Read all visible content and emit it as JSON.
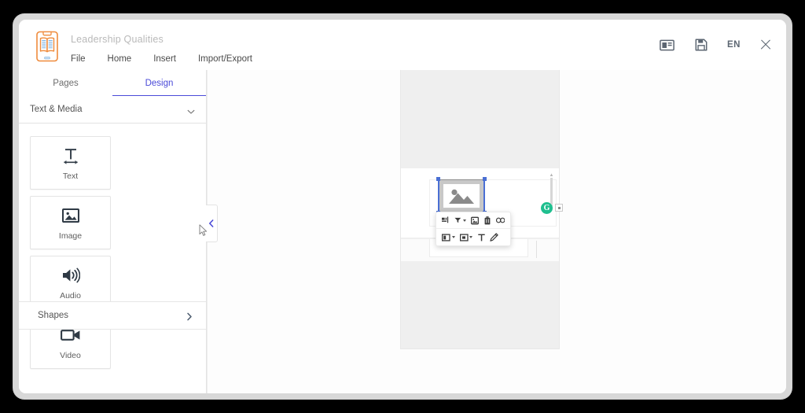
{
  "window": {
    "app_icon": "book-document-icon",
    "document_title": "Leadership Qualities",
    "menu": [
      {
        "label": "File",
        "name": "menu-file"
      },
      {
        "label": "Home",
        "name": "menu-home"
      },
      {
        "label": "Insert",
        "name": "menu-insert"
      },
      {
        "label": "Import/Export",
        "name": "menu-import-export"
      }
    ],
    "header_actions": {
      "layout_icon": "slide-layout-icon",
      "save_icon": "save-floppy-icon",
      "language": "EN",
      "close_icon": "close-icon"
    }
  },
  "left_panel": {
    "tabs": [
      {
        "label": "Pages",
        "active": false
      },
      {
        "label": "Design",
        "active": true
      }
    ],
    "accordion": {
      "label": "Text & Media",
      "expanded": true,
      "chevron": "chevron-down-icon"
    },
    "cards": [
      {
        "label": "Text",
        "icon": "text-size-icon"
      },
      {
        "label": "Image",
        "icon": "image-icon"
      },
      {
        "label": "Audio",
        "icon": "audio-speaker-icon"
      },
      {
        "label": "Video",
        "icon": "video-camera-icon"
      }
    ],
    "shapes": {
      "label": "Shapes",
      "chevron": "chevron-right-icon"
    },
    "collapse_handle": "chevron-left-icon"
  },
  "canvas": {
    "selected_object": {
      "type": "image-placeholder",
      "icon": "image-placeholder-icon",
      "selected": true
    },
    "sync_badge": {
      "label": "G",
      "color": "#1fbf8f",
      "name": "grammar-check-badge"
    },
    "floating_toolbar": {
      "row1": [
        {
          "icon": "align-icon",
          "name": "align-button"
        },
        {
          "icon": "filter-icon",
          "name": "filter-button",
          "has_caret": true
        },
        {
          "icon": "replace-image-icon",
          "name": "replace-image-button"
        },
        {
          "icon": "delete-trash-icon",
          "name": "delete-button"
        },
        {
          "icon": "link-icon",
          "name": "link-button"
        }
      ],
      "row2": [
        {
          "icon": "fill-color-icon",
          "name": "fill-color-button",
          "has_caret": true
        },
        {
          "icon": "border-color-icon",
          "name": "border-color-button",
          "has_caret": true
        },
        {
          "icon": "text-icon",
          "name": "text-button"
        },
        {
          "icon": "pencil-edit-icon",
          "name": "edit-button"
        }
      ]
    }
  },
  "colors": {
    "accent": "#4a4ad8",
    "brand_orange": "#ef8b3c",
    "selection": "#4a6fd4",
    "badge_green": "#1fbf8f"
  }
}
